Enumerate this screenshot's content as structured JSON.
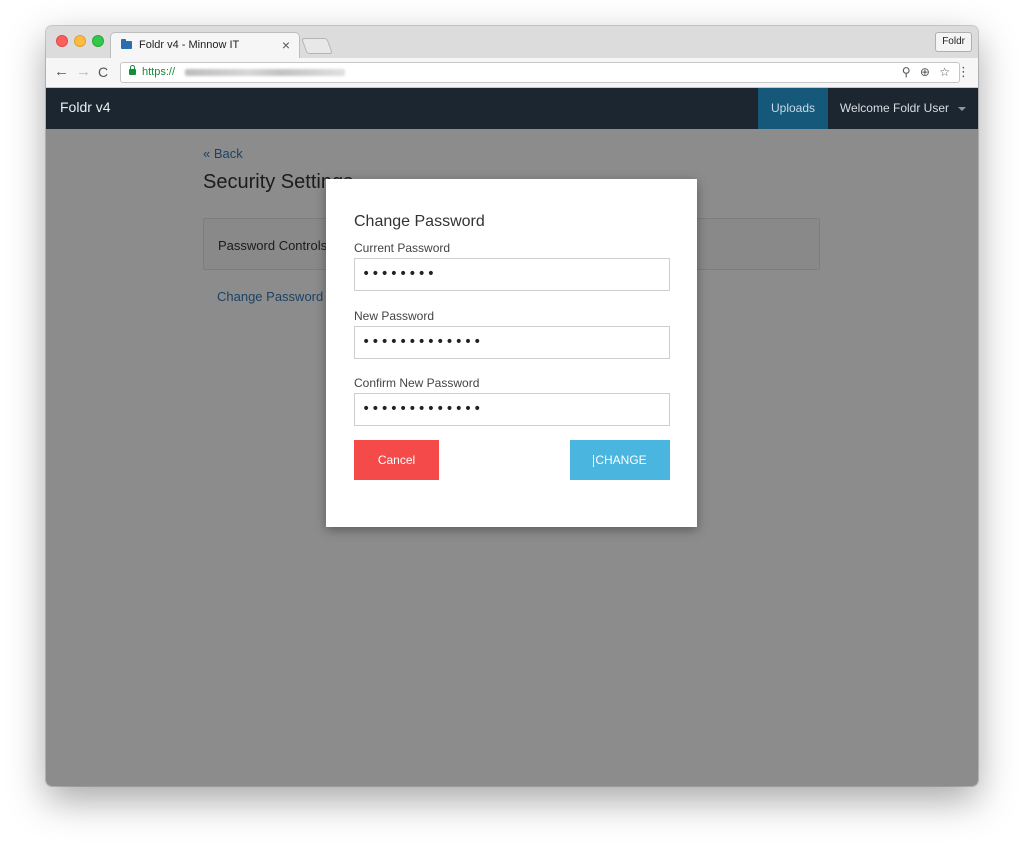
{
  "browser": {
    "tab_title": "Foldr v4 - Minnow IT",
    "tab_close": "×",
    "profile_button": "Foldr",
    "url_scheme": "https://",
    "nav_back": "←",
    "nav_forward": "→",
    "nav_reload": "C",
    "omnibox_icons": "⚲ ⊕ ☆",
    "menu": "⋮"
  },
  "navbar": {
    "brand": "Foldr v4",
    "uploads": "Uploads",
    "welcome": "Welcome Foldr User"
  },
  "page": {
    "back_link": "« Back",
    "title": "Security Settings",
    "panel_title": "Password Controls",
    "change_link": "Change Password"
  },
  "modal": {
    "title": "Change Password",
    "current_label": "Current Password",
    "current_value": "••••••••",
    "new_label": "New Password",
    "new_value": "•••••••••••••",
    "confirm_label": "Confirm New Password",
    "confirm_value": "•••••••••••••",
    "cancel": "Cancel",
    "change": "CHANGE"
  },
  "colors": {
    "navbar_bg": "#1b2631",
    "uploads_bg": "#15587a",
    "cancel_bg": "#f44a4a",
    "change_bg": "#4ab5df",
    "link": "#337ab7"
  }
}
